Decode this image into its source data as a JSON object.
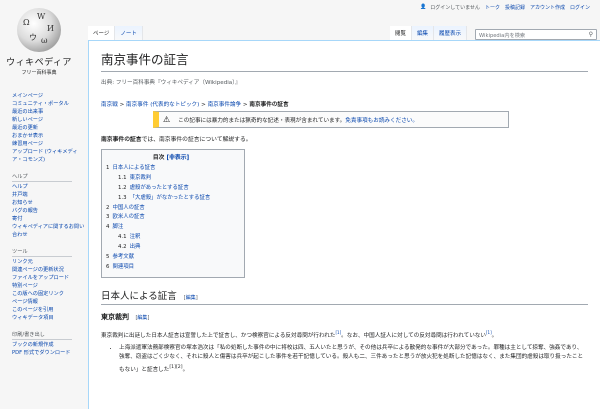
{
  "personal": {
    "not_logged_in": "ログインしていません",
    "talk": "トーク",
    "contributions": "投稿記録",
    "create_account": "アカウント作成",
    "login": "ログイン"
  },
  "logo": {
    "wordmark": "ウィキペディア",
    "tagline": "フリー百科事典"
  },
  "sidebar": {
    "nav_items": [
      "メインページ",
      "コミュニティ・ポータル",
      "最近の出来事",
      "新しいページ",
      "最近の更新",
      "おまかせ表示",
      "練習用ページ",
      "アップロード (ウィキメディア・コモンズ)"
    ],
    "help_heading": "ヘルプ",
    "help_items": [
      "ヘルプ",
      "井戸端",
      "お知らせ",
      "バグの報告",
      "寄付",
      "ウィキペディアに関するお問い合わせ"
    ],
    "tools_heading": "ツール",
    "tools_items": [
      "リンク元",
      "関連ページの更新状況",
      "ファイルをアップロード",
      "特別ページ",
      "この版への固定リンク",
      "ページ情報",
      "このページを引用",
      "ウィキデータ項目"
    ],
    "print_heading": "印刷/書き出し",
    "print_items": [
      "ブックの新規作成",
      "PDF 形式でダウンロード"
    ]
  },
  "tabs": {
    "page": "ページ",
    "talk": "ノート",
    "read": "閲覧",
    "edit": "編集",
    "history": "履歴表示"
  },
  "search": {
    "placeholder": "Wikipedia内を検索"
  },
  "article": {
    "title": "南京事件の証言",
    "site_sub": "出典: フリー百科事典『ウィキペディア（Wikipedia）』",
    "breadcrumb": {
      "items": [
        "南京戦",
        "南京事件 (代表的なトピック)",
        "南京事件論争"
      ],
      "sep": " > ",
      "current": "南京事件の証言"
    },
    "ambox_text": "この記事には暴力的または猟奇的な記述・表現が含まれています。",
    "ambox_link": "免責事項もお読みください。",
    "lead_bold": "南京事件の証言",
    "lead_rest": "では、南京事件の証言について解説する。",
    "toc": {
      "title": "目次",
      "toggle": "[非表示]",
      "items": [
        {
          "num": "1",
          "text": "日本人による証言",
          "level": 1
        },
        {
          "num": "1.1",
          "text": "東京裁判",
          "level": 2
        },
        {
          "num": "1.2",
          "text": "虐殺があったとする証言",
          "level": 2
        },
        {
          "num": "1.3",
          "text": "「大虐殺」がなかったとする証言",
          "level": 2
        },
        {
          "num": "2",
          "text": "中国人の証言",
          "level": 1
        },
        {
          "num": "3",
          "text": "欧米人の証言",
          "level": 1
        },
        {
          "num": "4",
          "text": "脚注",
          "level": 1
        },
        {
          "num": "4.1",
          "text": "注釈",
          "level": 2
        },
        {
          "num": "4.2",
          "text": "出典",
          "level": 2
        },
        {
          "num": "5",
          "text": "参考文献",
          "level": 1
        },
        {
          "num": "6",
          "text": "関連項目",
          "level": 1
        }
      ]
    },
    "section1": {
      "heading": "日本人による証言",
      "edit": "編集"
    },
    "section1_1": {
      "heading": "東京裁判",
      "edit": "編集"
    },
    "para1": "東京裁判に出廷した日本人証言は宣誓した上で証言し、かつ検察官による反対尋問が行われた",
    "para1_ref1": "[1]",
    "para1_rest": "。なお、中国人証人に対しての反対尋問は行われていない",
    "para1_ref2": "[1]",
    "para1_end": "。",
    "bullet1_a": "上海派遣軍法務部検察官の塚本浩次は「私の処断した事件の中に将校は四、五人いたと思うが、その他は兵卒による散発的な事件が大部分であった。罪種は主として掠奪、強姦であり、強奪、窃盗はごく少なく、それに殺人と傷害は兵卒が起こした事件を若干記憶している。殺人も二、三件あったと思うが放火犯を処断した記憶はなく、また集団的虐殺は取り扱ったこともない」と証言した",
    "bullet1_ref": "[1][2]",
    "bullet1_end": "。"
  }
}
